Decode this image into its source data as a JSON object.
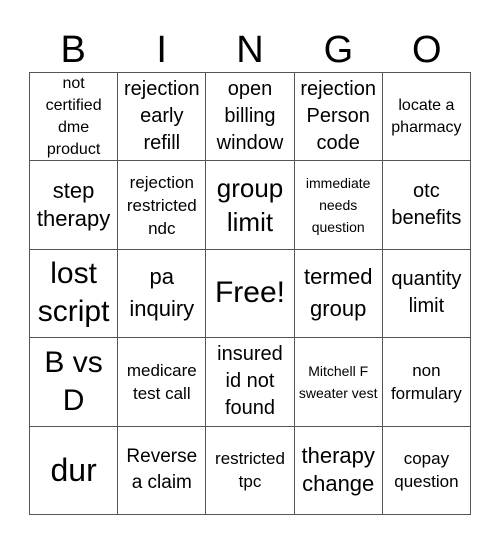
{
  "header": {
    "letters": [
      "B",
      "I",
      "N",
      "G",
      "O"
    ]
  },
  "grid": {
    "rows": [
      [
        "not certified dme product",
        "rejection early refill",
        "open billing window",
        "rejection Person code",
        "locate a pharmacy"
      ],
      [
        "step therapy",
        "rejection restricted ndc",
        "group limit",
        "immediate needs question",
        "otc benefits"
      ],
      [
        "lost script",
        "pa inquiry",
        "Free!",
        "termed group",
        "quantity limit"
      ],
      [
        "B vs D",
        "medicare test call",
        "insured id not found",
        "Mitchell F sweater vest",
        "non formulary"
      ],
      [
        "dur",
        "Reverse a claim",
        "restricted tpc",
        "therapy change",
        "copay question"
      ]
    ]
  }
}
